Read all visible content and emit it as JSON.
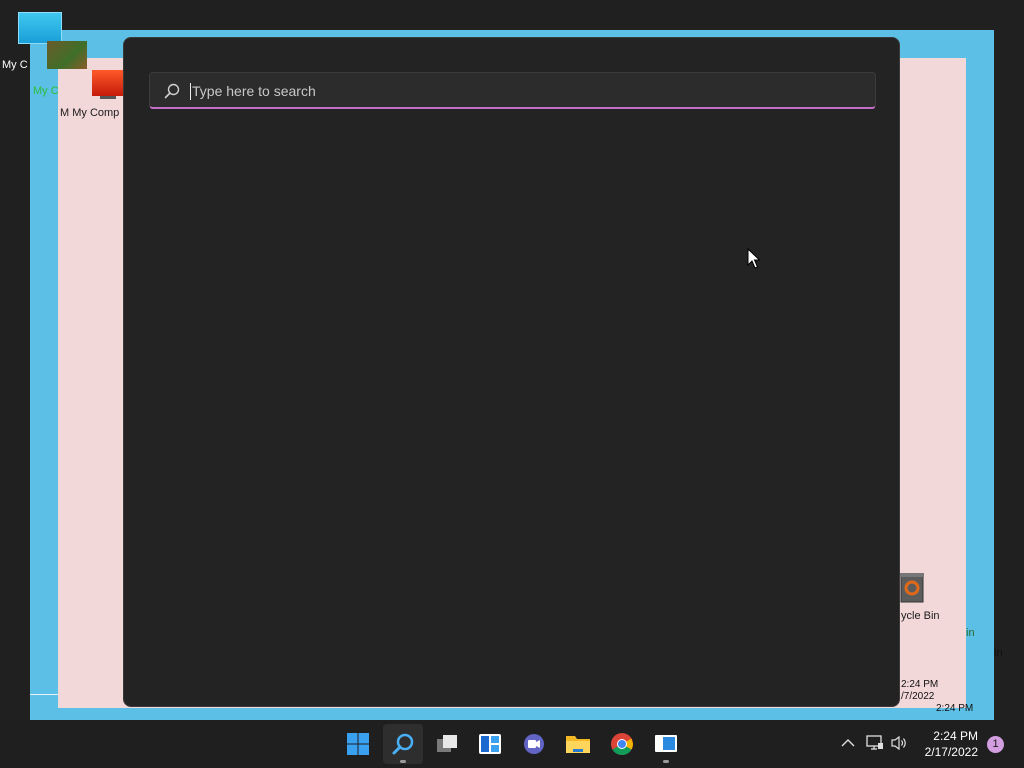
{
  "desktop": {
    "icons": [
      {
        "label": "My C",
        "name": "monitor-icon-1"
      },
      {
        "label": "My C",
        "name": "monitor-icon-2"
      },
      {
        "label": "M My Comp",
        "name": "monitor-icon-3"
      },
      {
        "label": "ycle Bin",
        "name": "recycle-bin-icon"
      },
      {
        "label": "in",
        "name": "recycle-bin-label-2"
      },
      {
        "label": "in",
        "name": "recycle-bin-label-3"
      }
    ],
    "ghost_clock": {
      "time": "2:24 PM",
      "date": "/7/2022",
      "time2": "2:24 PM"
    }
  },
  "search": {
    "placeholder": "Type here to search",
    "value": ""
  },
  "taskbar": {
    "apps": [
      {
        "name": "start-button",
        "icon": "windows-logo-icon"
      },
      {
        "name": "search-button",
        "icon": "search-icon",
        "active": true
      },
      {
        "name": "task-view-button",
        "icon": "task-view-icon"
      },
      {
        "name": "widgets-button",
        "icon": "widgets-icon"
      },
      {
        "name": "teams-chat-button",
        "icon": "teams-icon"
      },
      {
        "name": "file-explorer-button",
        "icon": "folder-icon"
      },
      {
        "name": "chrome-button",
        "icon": "chrome-icon"
      },
      {
        "name": "remote-desktop-button",
        "icon": "remote-desktop-icon",
        "running": true
      }
    ],
    "tray": {
      "time": "2:24 PM",
      "date": "2/17/2022",
      "notification_count": "1"
    }
  },
  "colors": {
    "accent": "#c56ec8",
    "desktop_blue": "#5bbfe6",
    "desktop_pink": "#f3d8da",
    "panel_bg": "#232323"
  }
}
